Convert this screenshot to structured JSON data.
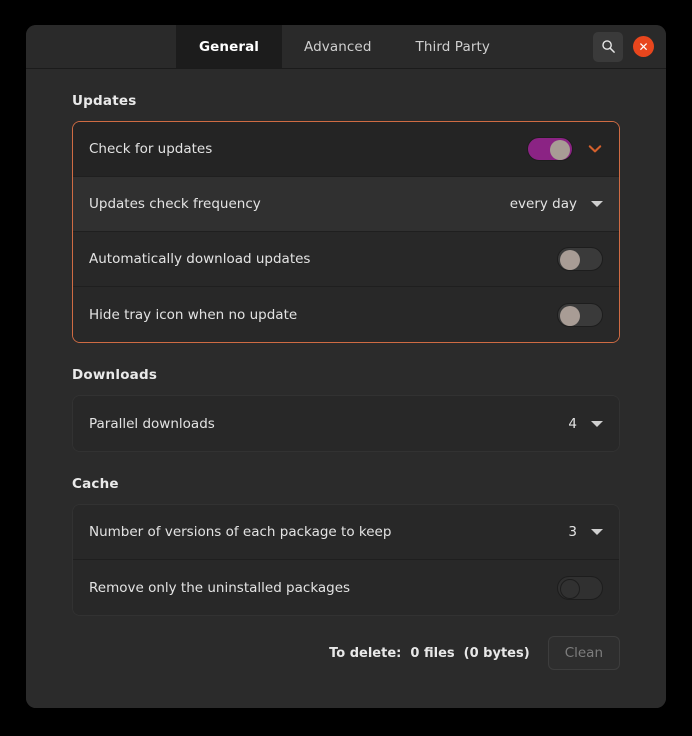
{
  "window": {
    "tabs": [
      {
        "label": "General",
        "active": true
      },
      {
        "label": "Advanced",
        "active": false
      },
      {
        "label": "Third Party",
        "active": false
      }
    ],
    "search_icon": "search-icon",
    "close_icon": "close-icon",
    "close_label": "✕"
  },
  "sections": {
    "updates": {
      "title": "Updates",
      "rows": {
        "check_for_updates": {
          "label": "Check for updates",
          "toggle": "on",
          "expander": "chevron-down-icon"
        },
        "frequency": {
          "label": "Updates check frequency",
          "value": "every day"
        },
        "auto_download": {
          "label": "Automatically download updates",
          "toggle": "off"
        },
        "hide_tray": {
          "label": "Hide tray icon when no update",
          "toggle": "off"
        }
      }
    },
    "downloads": {
      "title": "Downloads",
      "rows": {
        "parallel": {
          "label": "Parallel downloads",
          "value": "4"
        }
      }
    },
    "cache": {
      "title": "Cache",
      "rows": {
        "versions_keep": {
          "label": "Number of versions of each package to keep",
          "value": "3"
        },
        "remove_uninstalled": {
          "label": "Remove only the uninstalled packages",
          "toggle": "disabled"
        }
      },
      "footer": {
        "delete_info": "To delete:  0 files  (0 bytes)",
        "clean_label": "Clean"
      }
    }
  },
  "colors": {
    "accent_orange": "#cf6b43",
    "toggle_on": "#8b2384",
    "close_red": "#e8461d",
    "window_bg": "#2b2b2b"
  }
}
